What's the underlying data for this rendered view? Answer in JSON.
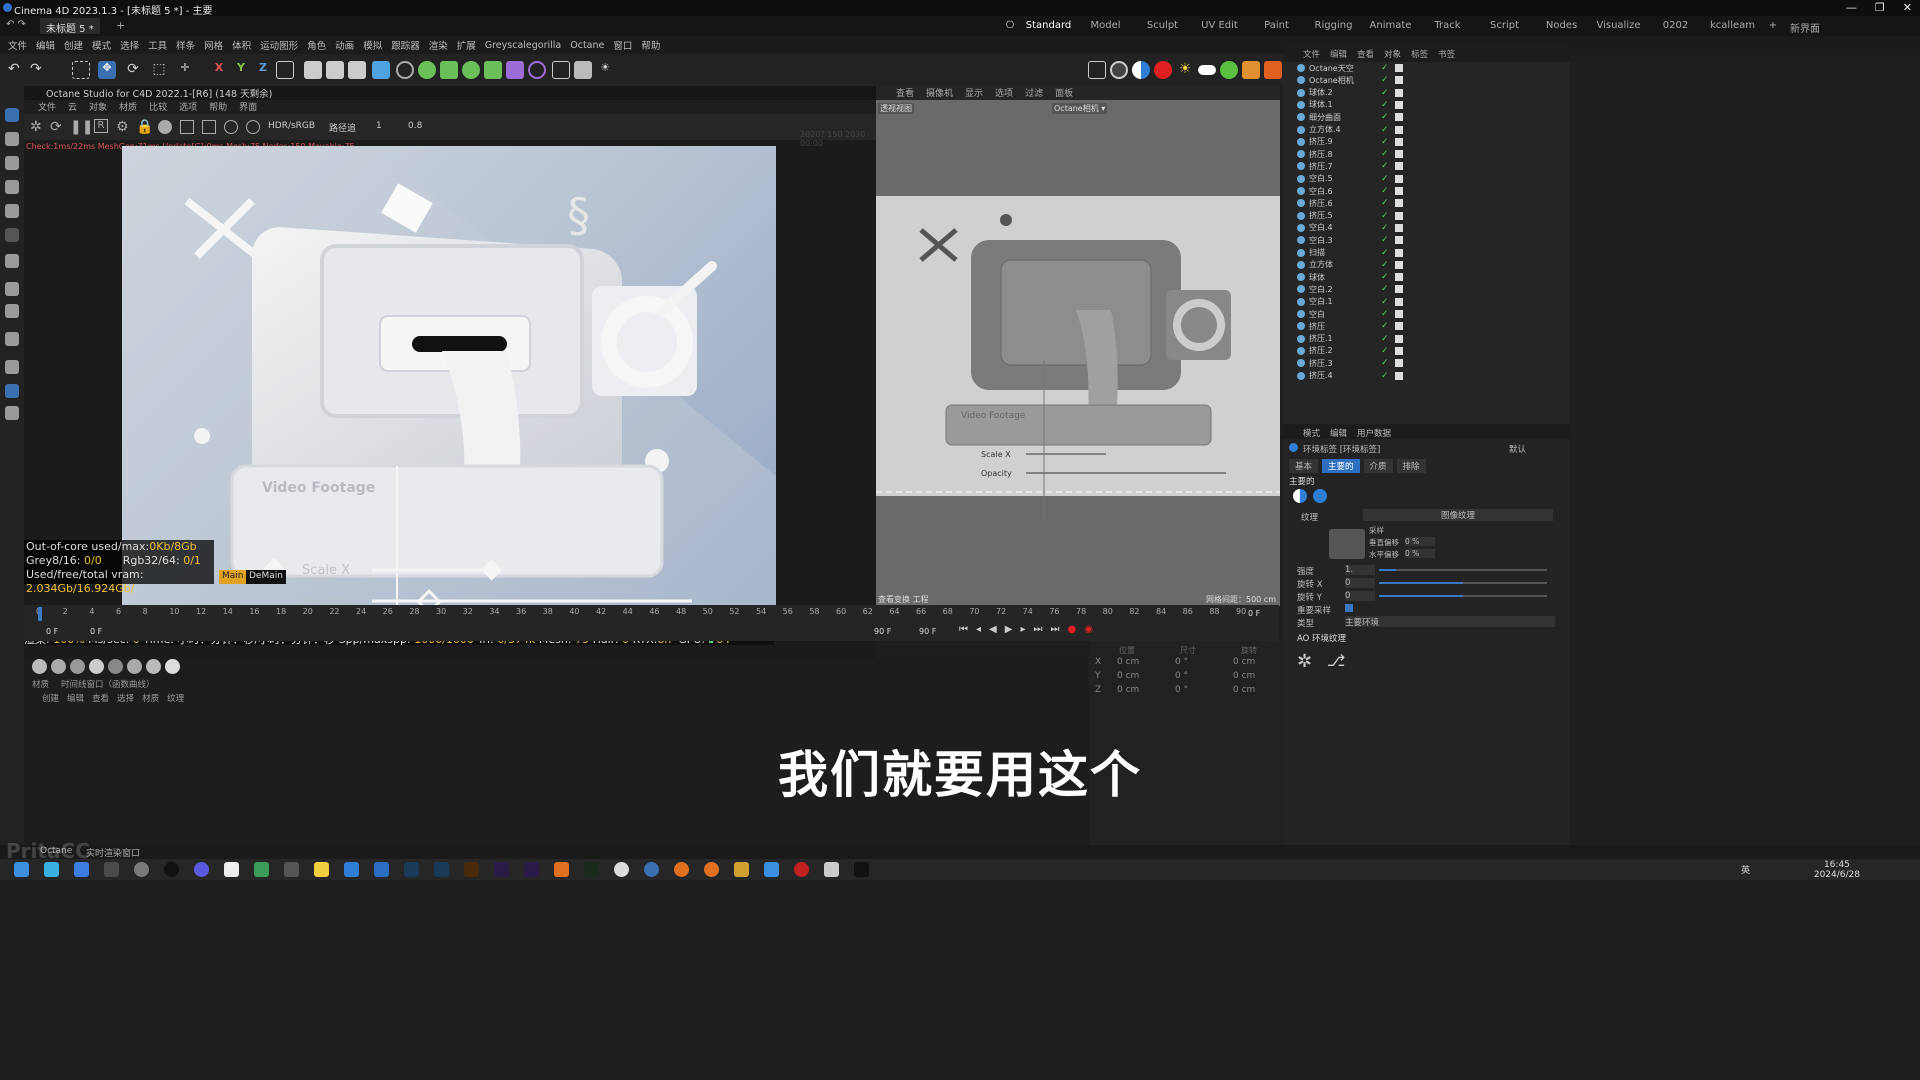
{
  "window": {
    "title": "Cinema 4D 2023.1.3 - [未标题 5 *] - 主要",
    "tab": "未标题 5 *",
    "controls": [
      "—",
      "❐",
      "✕"
    ]
  },
  "layouts": [
    "Standard",
    "Model",
    "Sculpt",
    "UV Edit",
    "Paint",
    "Rigging",
    "Animate",
    "Track",
    "Script",
    "Nodes",
    "Visualize",
    "0202",
    "kcalleam"
  ],
  "layouts_extra": [
    "+",
    "新界面"
  ],
  "menu": [
    "文件",
    "编辑",
    "创建",
    "模式",
    "选择",
    "工具",
    "样条",
    "网格",
    "体积",
    "运动图形",
    "角色",
    "动画",
    "模拟",
    "跟踪器",
    "渲染",
    "扩展",
    "Greyscalegorilla",
    "Octane",
    "窗口",
    "帮助"
  ],
  "octane": {
    "title": "Octane Studio for C4D 2022.1-[R6] (148 天剩余)",
    "menu": [
      "文件",
      "云",
      "对象",
      "材质",
      "比较",
      "选项",
      "帮助",
      "界面"
    ],
    "mode": "HDR/sRGB",
    "mode2": "路径追",
    "val1": "1",
    "val2": "0.8",
    "stats": "Check:1ms/22ms  MeshGen:71ms  Update[G]:0ms  Mesh:75 Nodes:159 Movable:75",
    "corner_note": "2020? 150.2030 00:00",
    "info": {
      "ooc_label": "Out-of-core used/max:",
      "ooc_val": "0Kb/8Gb",
      "grey_label": "Grey8/16:",
      "grey_val": "0/0",
      "rgb_label": "Rgb32/64:",
      "rgb_val": "0/1",
      "vram_label": "Used/free/total vram:",
      "vram_val": "2.034Gb/16.924Gb/",
      "vram_tag": "Main",
      "vram_tag2": "DeMain"
    },
    "footer": {
      "render_label": "渲染:",
      "render_val": "100%",
      "mssec_label": "Ms/sec:",
      "mssec_val": "0",
      "time": "Time: 小时：分钟：秒/小时：分钟：秒",
      "spp_label": "Spp/maxspp:",
      "spp_val": "1000/1000",
      "tri_label": "Tri:",
      "tri_val": "0/374k",
      "mesh_label": "Mesh:",
      "mesh_val": "75",
      "hair_label": "Hair:",
      "hair_val": "0",
      "rtx_label": "RTX:",
      "rtx_val": "on",
      "gpu_label": "GPU:",
      "gpu_val": "64"
    },
    "scene_text": {
      "video_footage": "Video Footage",
      "scale_x": "Scale X",
      "opacity": "Opacity"
    }
  },
  "viewport": {
    "menu": [
      "查看",
      "摄像机",
      "显示",
      "选项",
      "过滤",
      "面板"
    ],
    "label_left": "透视视图",
    "label_center": "Octane相机 ▾",
    "scene_text": {
      "video_footage": "Video Footage",
      "scale_x": "Scale X",
      "opacity": "Opacity"
    },
    "footer_left": "查看变换",
    "footer_left2": "工程",
    "footer_right": "网格间距：500 cm"
  },
  "objects": {
    "menu": [
      "文件",
      "编辑",
      "查看",
      "对象",
      "标签",
      "书签"
    ],
    "items": [
      "Octane天空",
      "Octane相机",
      "球体.2",
      "球体.1",
      "细分曲面",
      "立方体.4",
      "挤压.9",
      "挤压.8",
      "挤压.7",
      "空白.5",
      "空白.6",
      "挤压.6",
      "挤压.5",
      "空白.4",
      "空白.3",
      "扫描",
      "立方体",
      "球体",
      "空白.2",
      "空白.1",
      "空白",
      "挤压",
      "挤压.1",
      "挤压.2",
      "挤压.3",
      "挤压.4"
    ]
  },
  "attributes": {
    "menu": [
      "模式",
      "编辑",
      "用户数据"
    ],
    "object": "环境标签 [环境标签]",
    "preset": "默认",
    "tabs": [
      "基本",
      "主要的",
      "介质",
      "排除"
    ],
    "section": "主要的",
    "texture_label": "纹理",
    "texture_value": "图像纹理",
    "sub1_label": "垂直偏移",
    "sub1_val": "0 %",
    "sub2_label": "水平偏移",
    "sub2_val": "0 %",
    "sub0": "采样",
    "power_label": "强度",
    "power_val": "1.",
    "rotx_label": "旋转 X",
    "rotx_val": "0",
    "roty_label": "旋转 Y",
    "roty_val": "0",
    "importance_label": "重要采样",
    "type_label": "类型",
    "type_val": "主要环境",
    "ao_label": "AO 环境纹理"
  },
  "timeline": {
    "ticks": [
      "0",
      "2",
      "4",
      "6",
      "8",
      "10",
      "12",
      "14",
      "16",
      "18",
      "20",
      "22",
      "24",
      "26",
      "28",
      "30",
      "32",
      "34",
      "36",
      "38",
      "40",
      "42",
      "44",
      "46",
      "48",
      "50",
      "52",
      "54",
      "56",
      "58",
      "60",
      "62",
      "64",
      "66",
      "68",
      "70",
      "72",
      "74",
      "76",
      "78",
      "80",
      "82",
      "84",
      "86",
      "88",
      "90"
    ],
    "start": "0 F",
    "start2": "0 F",
    "end": "90 F",
    "end2": "90 F",
    "current": "0 F"
  },
  "material_mgr": {
    "tabs": [
      "材质",
      "时间线窗口（函数曲线）"
    ],
    "menu": [
      "创建",
      "编辑",
      "查看",
      "选择",
      "材质",
      "纹理"
    ]
  },
  "coords": {
    "rows": [
      {
        "axis": "X",
        "pos": "0 cm",
        "rot": "0 °",
        "size": "0 cm"
      },
      {
        "axis": "Y",
        "pos": "0 cm",
        "rot": "0 °",
        "size": "0 cm"
      },
      {
        "axis": "Z",
        "pos": "0 cm",
        "rot": "0 °",
        "size": "0 cm"
      }
    ],
    "head": [
      "位置",
      "尺寸",
      "旋转"
    ]
  },
  "subtitle": "我们就要用这个",
  "statusbar": {
    "left": "Octane",
    "mid": "实时渲染窗口",
    "watermark": "PritaCC"
  },
  "taskbar": {
    "time": "16:45",
    "date": "2024/6/28",
    "lang": "英"
  },
  "colors": {
    "accent_blue": "#2f7fd6",
    "check_green": "#4cd26a",
    "stat_red": "#d35454",
    "highlight_yellow": "#f0c030"
  }
}
